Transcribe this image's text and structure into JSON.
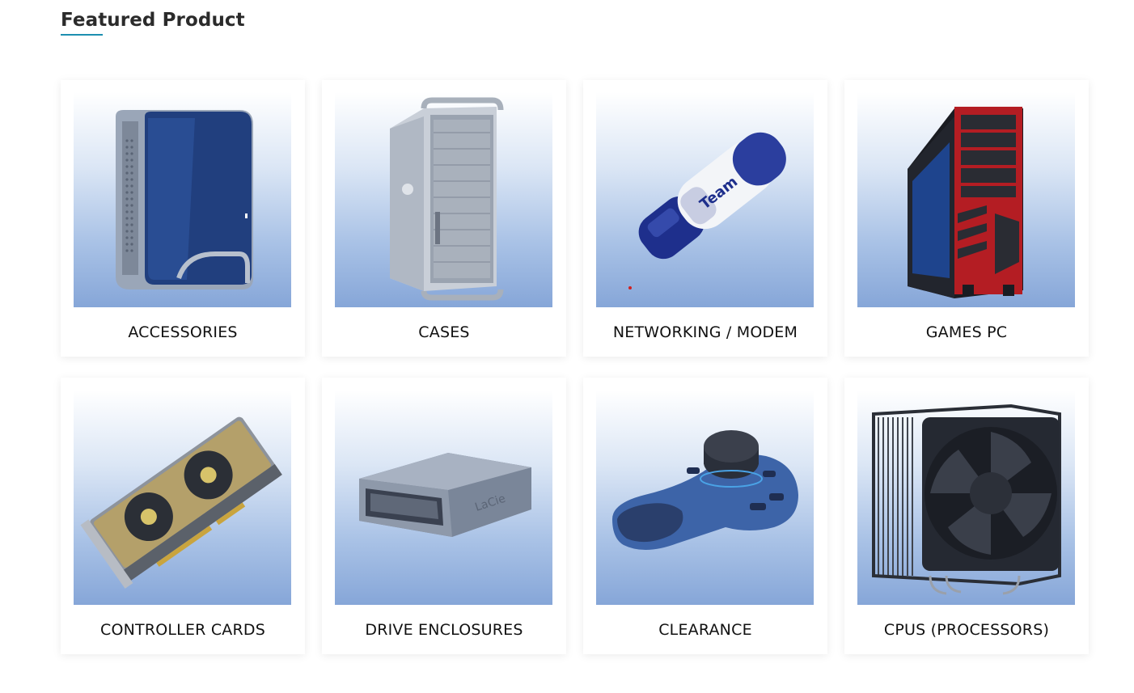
{
  "section": {
    "title": "Featured Product"
  },
  "categories": [
    {
      "label": "ACCESSORIES",
      "icon": "external-hard-drive-icon"
    },
    {
      "label": "CASES",
      "icon": "tower-case-icon"
    },
    {
      "label": "NETWORKING / MODEM",
      "icon": "usb-stick-icon"
    },
    {
      "label": "GAMES PC",
      "icon": "gaming-pc-icon"
    },
    {
      "label": "CONTROLLER CARDS",
      "icon": "graphics-card-icon"
    },
    {
      "label": "DRIVE ENCLOSURES",
      "icon": "drive-enclosure-icon"
    },
    {
      "label": "CLEARANCE",
      "icon": "3d-mouse-icon"
    },
    {
      "label": "CPUS (PROCESSORS)",
      "icon": "cpu-cooler-icon"
    }
  ],
  "colors": {
    "accent": "#1d8fb0",
    "image_gradient_top": "#ffffff",
    "image_gradient_bottom": "#86a6d8"
  }
}
